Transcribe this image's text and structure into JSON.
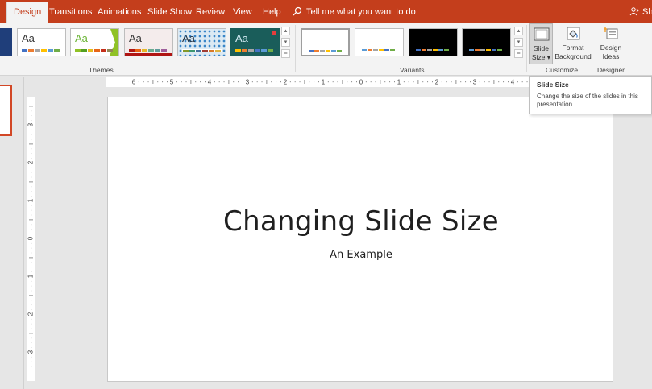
{
  "tabs": [
    {
      "label": "Design",
      "active": true
    },
    {
      "label": "Transitions"
    },
    {
      "label": "Animations"
    },
    {
      "label": "Slide Show"
    },
    {
      "label": "Review"
    },
    {
      "label": "View"
    },
    {
      "label": "Help"
    }
  ],
  "tell_me": "Tell me what you want to do",
  "share": "Sha",
  "groups": {
    "themes": "Themes",
    "variants": "Variants",
    "customize": "Customize",
    "designer": "Designer"
  },
  "themes": [
    {
      "name": "dark-blue",
      "sample": ""
    },
    {
      "name": "office",
      "sample": "Aa",
      "bars": [
        "#4472c4",
        "#ed7d31",
        "#a5a5a5",
        "#ffc000",
        "#5b9bd5",
        "#70ad47"
      ]
    },
    {
      "name": "facet",
      "sample": "Aa",
      "sample_color": "#6ab434",
      "bars": [
        "#90c226",
        "#54a021",
        "#e6b91e",
        "#e76618",
        "#c42f1a",
        "#918655"
      ]
    },
    {
      "name": "ion-boardroom",
      "sample": "Aa",
      "bars": [
        "#b01513",
        "#ea6312",
        "#e6b729",
        "#6aac90",
        "#5f9c9d",
        "#9e5e9b"
      ]
    },
    {
      "name": "organic",
      "sample": "Aa",
      "bars": [
        "#83992a",
        "#3c9770",
        "#44709d",
        "#a23c33",
        "#d97828",
        "#deb340"
      ]
    },
    {
      "name": "ion",
      "sample": "Aa",
      "sample_color": "#cfe8f0",
      "bars": [
        "#ffc000",
        "#ed7d31",
        "#a5a5a5",
        "#4472c4",
        "#5b9bd5",
        "#70ad47"
      ]
    }
  ],
  "variants": [
    {
      "name": "variant-1",
      "bg": "#ffffff",
      "bars": [
        "#4472c4",
        "#ed7d31",
        "#a5a5a5",
        "#ffc000",
        "#5b9bd5",
        "#70ad47"
      ]
    },
    {
      "name": "variant-2",
      "bg": "#ffffff",
      "bars": [
        "#5b9bd5",
        "#ed7d31",
        "#a5a5a5",
        "#ffc000",
        "#4472c4",
        "#70ad47"
      ]
    },
    {
      "name": "variant-3",
      "bg": "#000000",
      "bars": [
        "#4472c4",
        "#ed7d31",
        "#a5a5a5",
        "#ffc000",
        "#5b9bd5",
        "#70ad47"
      ]
    },
    {
      "name": "variant-4",
      "bg": "#000000",
      "bars": [
        "#5b9bd5",
        "#ed7d31",
        "#a5a5a5",
        "#ffc000",
        "#4472c4",
        "#70ad47"
      ]
    }
  ],
  "buttons": {
    "slide_size": {
      "line1": "Slide",
      "line2": "Size ▾"
    },
    "format_background": {
      "line1": "Format",
      "line2": "Background"
    },
    "design_ideas": {
      "line1": "Design",
      "line2": "Ideas"
    }
  },
  "tooltip": {
    "title": "Slide Size",
    "desc": "Change the size of the slides in this presentation."
  },
  "slide": {
    "title": "Changing Slide Size",
    "subtitle": "An Example"
  },
  "ruler": {
    "h_labels": [
      "6",
      "5",
      "4",
      "3",
      "2",
      "1",
      "0",
      "1",
      "2",
      "3",
      "4"
    ],
    "v_labels": [
      "3",
      "2",
      "1",
      "0",
      "1",
      "2",
      "3"
    ]
  },
  "colors": {
    "accent": "#c43e1c",
    "ribbon": "#f3f3f3",
    "workspace": "#e6e6e6"
  }
}
